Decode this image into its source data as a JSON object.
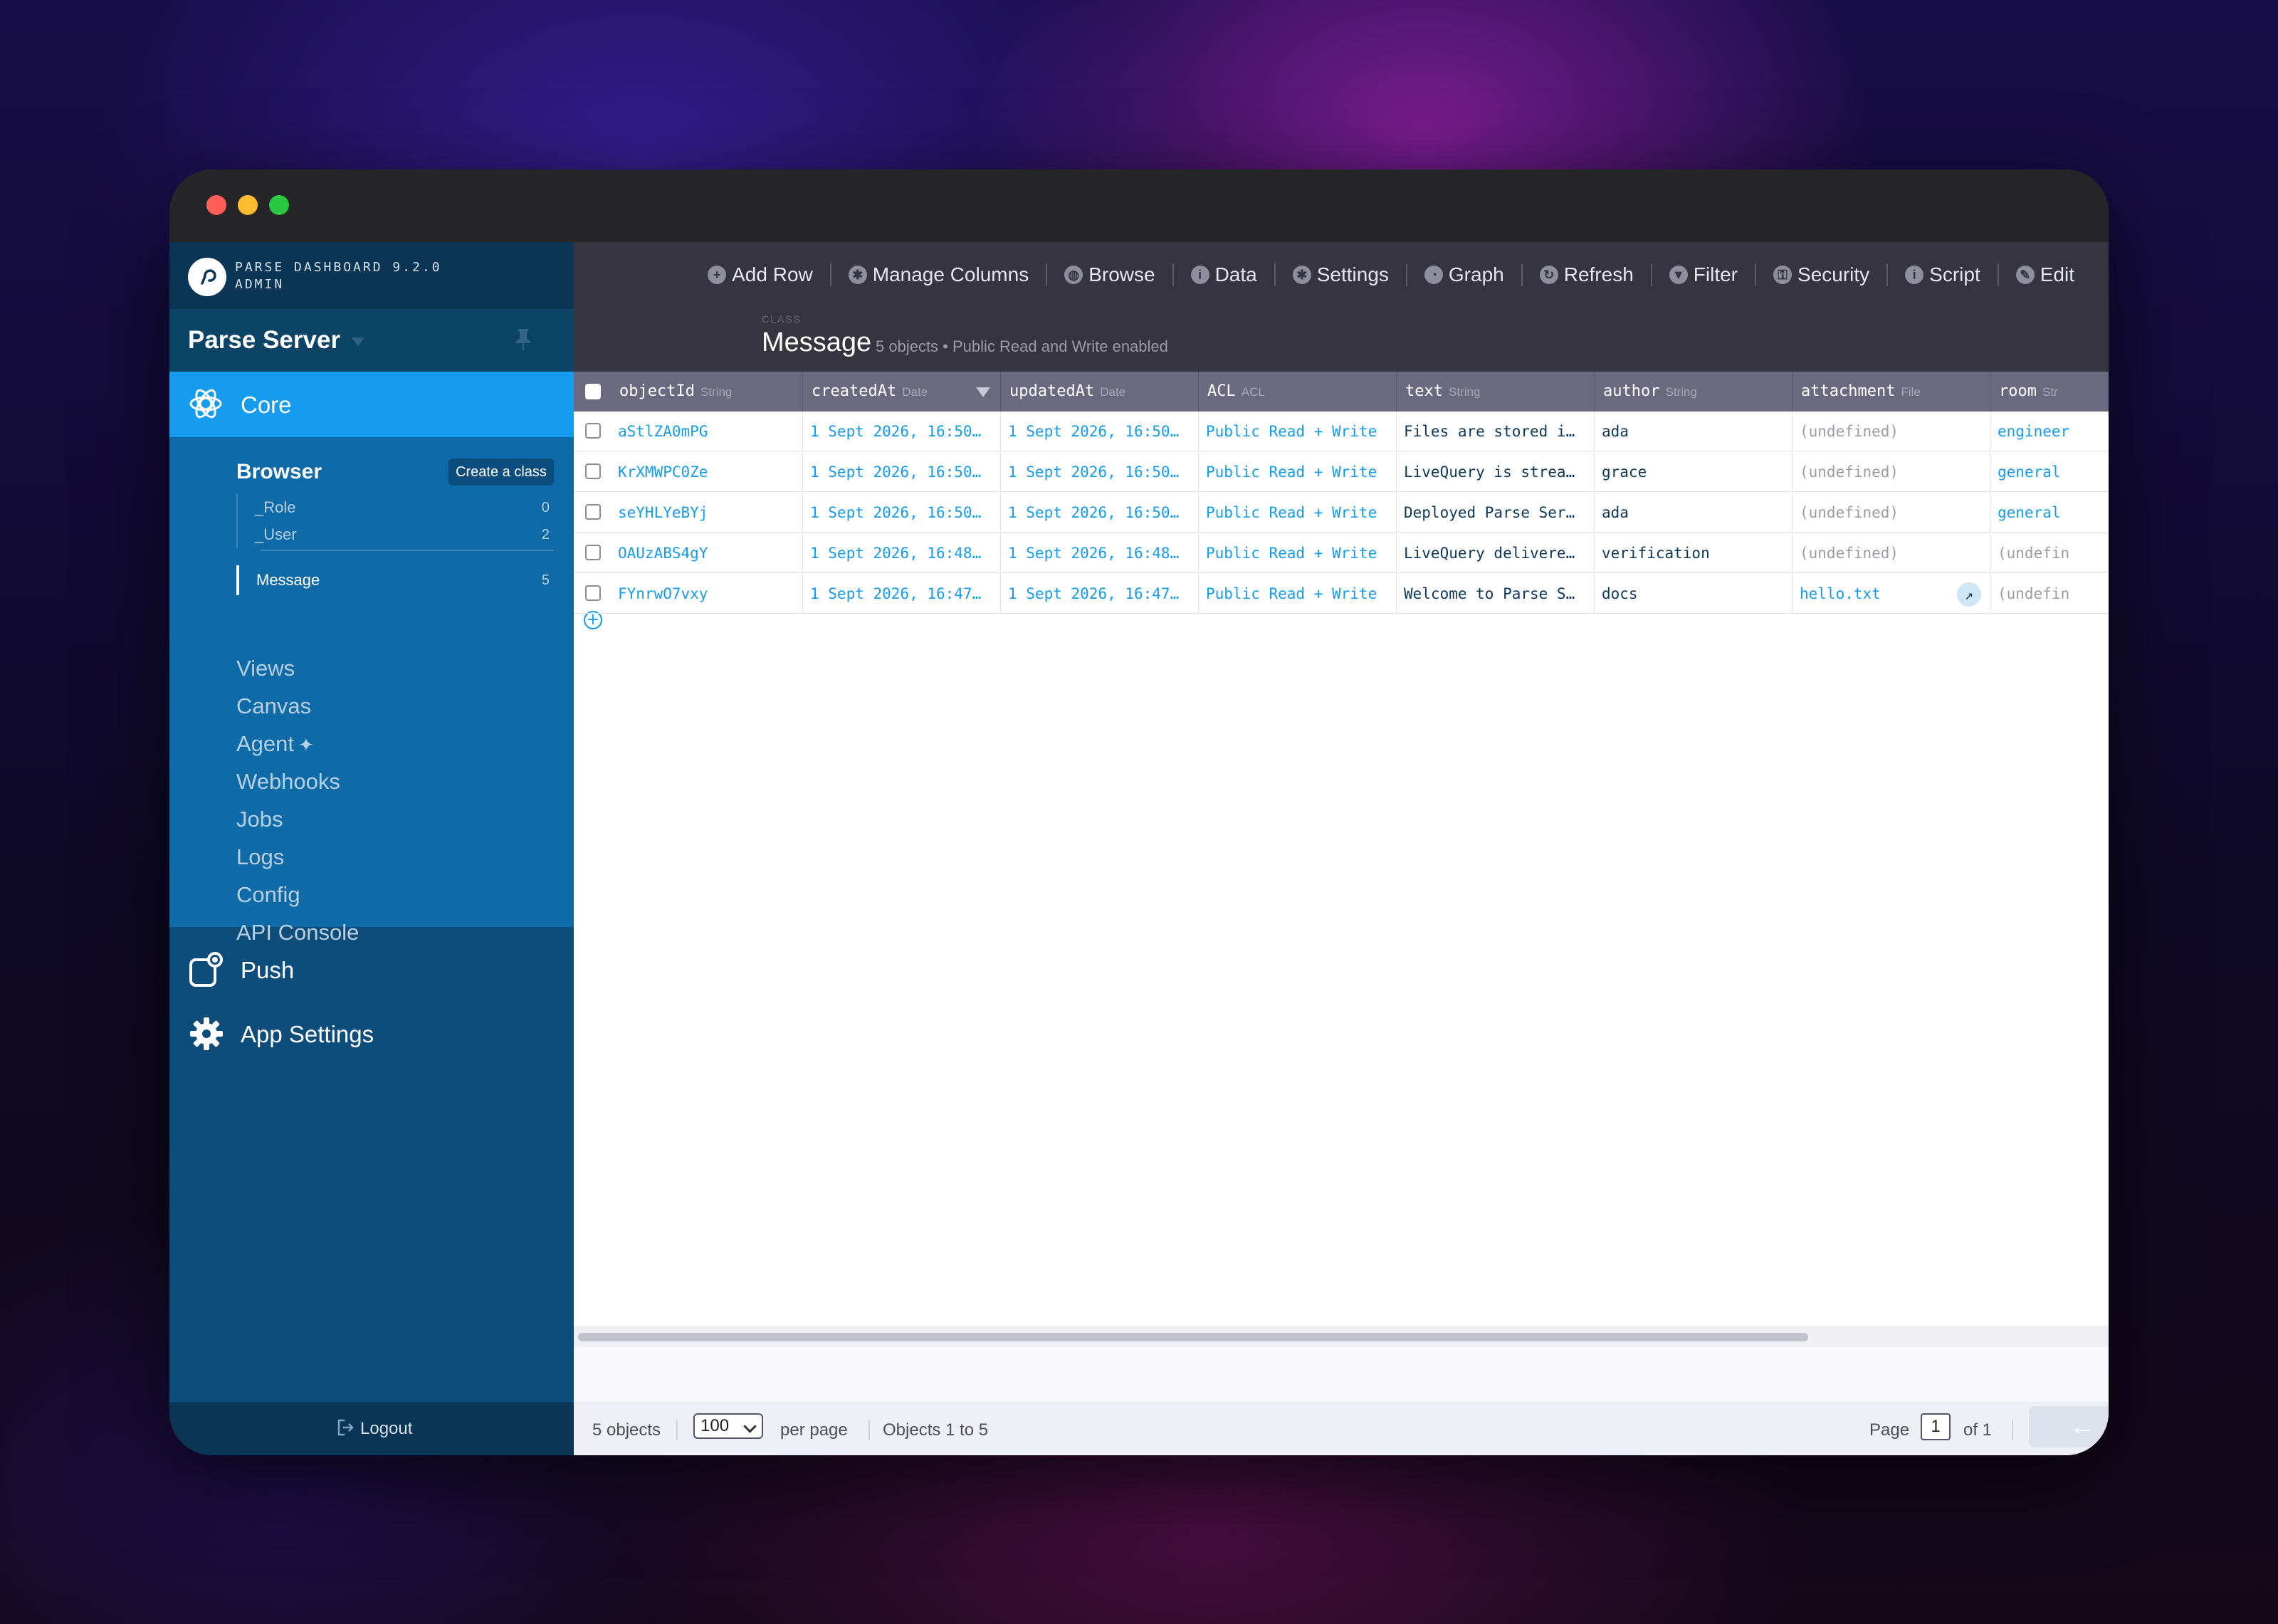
{
  "brand": {
    "line1": "PARSE DASHBOARD 9.2.0",
    "line2": "ADMIN"
  },
  "app": {
    "name": "Parse Server"
  },
  "nav": {
    "core_label": "Core",
    "browser_title": "Browser",
    "create_class": "Create a class",
    "classes": [
      {
        "name": "_Role",
        "count": "0"
      },
      {
        "name": "_User",
        "count": "2"
      },
      {
        "name": "Message",
        "count": "5"
      }
    ],
    "items": [
      "Views",
      "Canvas",
      "Agent",
      "Webhooks",
      "Jobs",
      "Logs",
      "Config",
      "API Console"
    ],
    "push_label": "Push",
    "app_settings_label": "App Settings",
    "logout": "Logout"
  },
  "toolbar": {
    "items": [
      "Add Row",
      "Manage Columns",
      "Browse",
      "Data",
      "Settings",
      "Graph",
      "Refresh",
      "Filter",
      "Security",
      "Script",
      "Edit"
    ],
    "icons": [
      "plus-circle-icon",
      "gear-icon",
      "users-icon",
      "info-icon",
      "gear-icon",
      "graph-icon",
      "refresh-icon",
      "filter-icon",
      "lock-icon",
      "script-icon",
      "edit-icon"
    ]
  },
  "class_header": {
    "tag": "CLASS",
    "name": "Message",
    "subtitle": "5 objects • Public Read and Write enabled"
  },
  "table": {
    "columns": [
      {
        "name": "objectId",
        "type": "String"
      },
      {
        "name": "createdAt",
        "type": "Date"
      },
      {
        "name": "updatedAt",
        "type": "Date"
      },
      {
        "name": "ACL",
        "type": "ACL"
      },
      {
        "name": "text",
        "type": "String"
      },
      {
        "name": "author",
        "type": "String"
      },
      {
        "name": "attachment",
        "type": "File"
      },
      {
        "name": "room",
        "type": "Str"
      }
    ],
    "rows": [
      [
        "aStlZA0mPG",
        "1 Sept 2026, 16:50…",
        "1 Sept 2026, 16:50…",
        "Public Read + Write",
        "Files are stored i…",
        "ada",
        "(undefined)",
        "engineer"
      ],
      [
        "KrXMWPC0Ze",
        "1 Sept 2026, 16:50…",
        "1 Sept 2026, 16:50…",
        "Public Read + Write",
        "LiveQuery is strea…",
        "grace",
        "(undefined)",
        "general"
      ],
      [
        "seYHLYeBYj",
        "1 Sept 2026, 16:50…",
        "1 Sept 2026, 16:50…",
        "Public Read + Write",
        "Deployed Parse Ser…",
        "ada",
        "(undefined)",
        "general"
      ],
      [
        "OAUzABS4gY",
        "1 Sept 2026, 16:48…",
        "1 Sept 2026, 16:48…",
        "Public Read + Write",
        "LiveQuery delivere…",
        "verification",
        "(undefined)",
        "(undefin"
      ],
      [
        "FYnrwO7vxy",
        "1 Sept 2026, 16:47…",
        "1 Sept 2026, 16:47…",
        "Public Read + Write",
        "Welcome to Parse S…",
        "docs",
        "hello.txt",
        "(undefin"
      ]
    ]
  },
  "footer": {
    "count": "5 objects",
    "per_page_value": "100",
    "per_page_label": "per page",
    "range": "Objects 1 to 5",
    "page_label": "Page",
    "page_value": "1",
    "of_label": "of 1",
    "prev": "←",
    "next": "→"
  },
  "colors": {
    "sidebar": "#0e4d7a",
    "accent": "#169cee",
    "toolbar": "#35343f",
    "header_row": "#6a6980"
  }
}
